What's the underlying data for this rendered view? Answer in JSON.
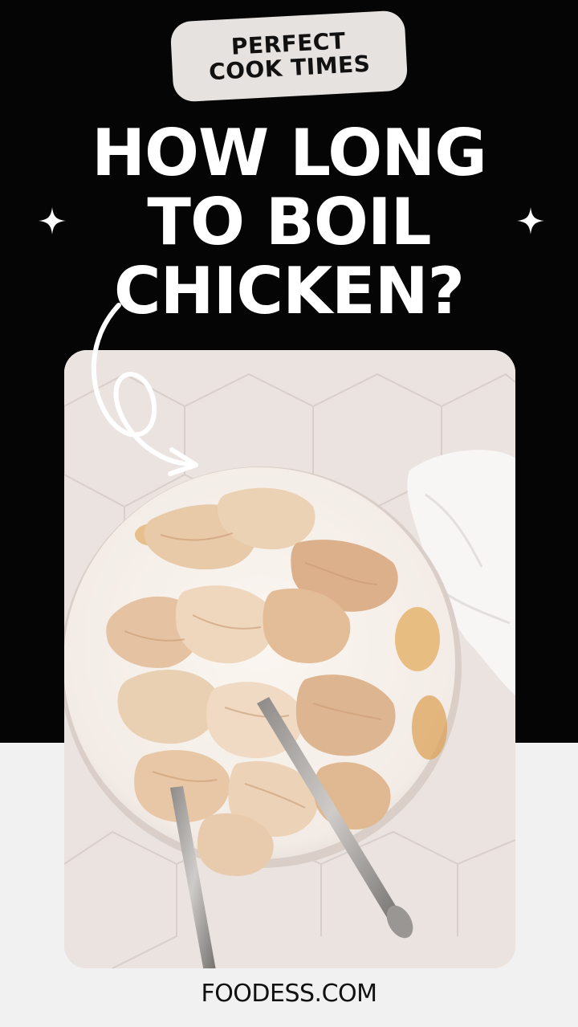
{
  "badge": {
    "line1": "PERFECT",
    "line2": "COOK TIMES"
  },
  "headline": {
    "line1": "HOW LONG",
    "line2": "TO BOIL",
    "line3": "CHICKEN?"
  },
  "photo": {
    "subject": "shredded boiled chicken on a white plate with two forks"
  },
  "footer": {
    "site": "FOODESS.COM"
  },
  "colors": {
    "background_top": "#050505",
    "background_bottom": "#f1f1f1",
    "badge": "#e6e2df",
    "text_light": "#ffffff",
    "text_dark": "#111111"
  },
  "icons": [
    "sparkle-icon",
    "curly-arrow-icon"
  ]
}
